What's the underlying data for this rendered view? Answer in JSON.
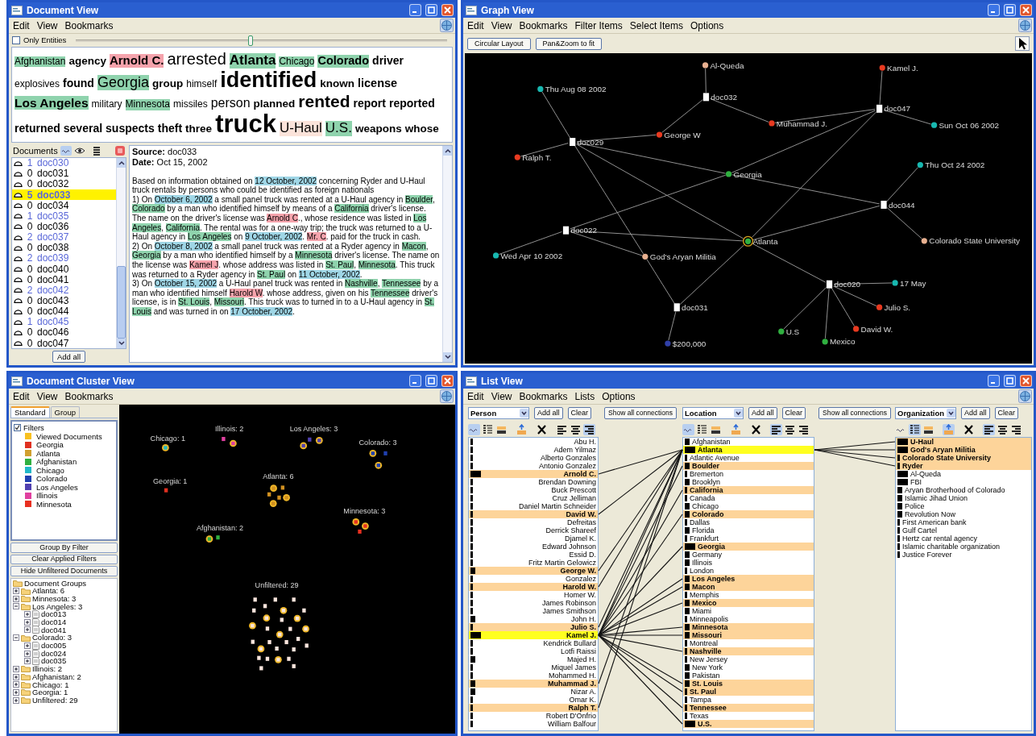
{
  "document_view": {
    "title": "Document View",
    "menu": [
      "Edit",
      "View",
      "Bookmarks"
    ],
    "only_entities": {
      "label": "Only Entities",
      "checked": false
    },
    "slider": {
      "level": 0.47
    },
    "word_cloud": [
      {
        "text": "Afghanistan",
        "kind": "location"
      },
      {
        "text": "agency",
        "kind": "term"
      },
      {
        "text": "Arnold C.",
        "kind": "person"
      },
      {
        "text": "arrested",
        "kind": "term"
      },
      {
        "text": "Atlanta",
        "kind": "location"
      },
      {
        "text": "Chicago",
        "kind": "location"
      },
      {
        "text": "Colorado",
        "kind": "location"
      },
      {
        "text": "driver",
        "kind": "term"
      },
      {
        "text": "explosives",
        "kind": "term"
      },
      {
        "text": "found",
        "kind": "term"
      },
      {
        "text": "Georgia",
        "kind": "location"
      },
      {
        "text": "group",
        "kind": "term"
      },
      {
        "text": "himself",
        "kind": "term"
      },
      {
        "text": "identified",
        "kind": "term"
      },
      {
        "text": "known",
        "kind": "term"
      },
      {
        "text": "license",
        "kind": "term"
      },
      {
        "text": "Los Angeles",
        "kind": "location"
      },
      {
        "text": "military",
        "kind": "term"
      },
      {
        "text": "Minnesota",
        "kind": "location"
      },
      {
        "text": "missiles",
        "kind": "term"
      },
      {
        "text": "person",
        "kind": "term"
      },
      {
        "text": "planned",
        "kind": "term"
      },
      {
        "text": "rented",
        "kind": "term"
      },
      {
        "text": "report",
        "kind": "term"
      },
      {
        "text": "reported",
        "kind": "term"
      },
      {
        "text": "returned",
        "kind": "term"
      },
      {
        "text": "several",
        "kind": "term"
      },
      {
        "text": "suspects",
        "kind": "term"
      },
      {
        "text": "theft",
        "kind": "term"
      },
      {
        "text": "three",
        "kind": "term"
      },
      {
        "text": "truck",
        "kind": "term"
      },
      {
        "text": "U-Haul",
        "kind": "organization"
      },
      {
        "text": "U.S.",
        "kind": "location"
      },
      {
        "text": "weapons",
        "kind": "term"
      },
      {
        "text": "whose",
        "kind": "term"
      }
    ],
    "documents_panel": {
      "title": "Documents",
      "add_all": "Add all",
      "items": [
        {
          "count": "1",
          "name": "doc030",
          "linked": true,
          "selected": false
        },
        {
          "count": "0",
          "name": "doc031",
          "linked": false,
          "selected": false
        },
        {
          "count": "0",
          "name": "doc032",
          "linked": false,
          "selected": false
        },
        {
          "count": "5",
          "name": "doc033",
          "linked": true,
          "selected": true
        },
        {
          "count": "0",
          "name": "doc034",
          "linked": false,
          "selected": false
        },
        {
          "count": "1",
          "name": "doc035",
          "linked": true,
          "selected": false
        },
        {
          "count": "0",
          "name": "doc036",
          "linked": false,
          "selected": false
        },
        {
          "count": "2",
          "name": "doc037",
          "linked": true,
          "selected": false
        },
        {
          "count": "0",
          "name": "doc038",
          "linked": false,
          "selected": false
        },
        {
          "count": "2",
          "name": "doc039",
          "linked": true,
          "selected": false
        },
        {
          "count": "0",
          "name": "doc040",
          "linked": false,
          "selected": false
        },
        {
          "count": "0",
          "name": "doc041",
          "linked": false,
          "selected": false
        },
        {
          "count": "2",
          "name": "doc042",
          "linked": true,
          "selected": false
        },
        {
          "count": "0",
          "name": "doc043",
          "linked": false,
          "selected": false
        },
        {
          "count": "0",
          "name": "doc044",
          "linked": false,
          "selected": false
        },
        {
          "count": "1",
          "name": "doc045",
          "linked": true,
          "selected": false
        },
        {
          "count": "0",
          "name": "doc046",
          "linked": false,
          "selected": false
        },
        {
          "count": "0",
          "name": "doc047",
          "linked": false,
          "selected": false
        }
      ]
    },
    "document": {
      "source": "**Source:** doc033",
      "date": "**Date:** Oct 15, 2002",
      "paragraphs": [
        [
          {
            "text": "Based on information obtained on "
          },
          {
            "text": "12 October, 2002",
            "kind": "date"
          },
          {
            "text": " concerning Ryder and U-Haul truck rentals by persons who could be identified as foreign nationals"
          }
        ],
        [
          {
            "text": "1) On "
          },
          {
            "text": "October 6, 2002",
            "kind": "date"
          },
          {
            "text": " a small panel truck was rented at a U-Haul agency in "
          },
          {
            "text": "Boulder",
            "kind": "location"
          },
          {
            "text": ", "
          },
          {
            "text": "Colorado",
            "kind": "location"
          },
          {
            "text": " by a man who identified himself by means of a "
          },
          {
            "text": "California",
            "kind": "location"
          },
          {
            "text": " driver's license. The name on the driver's license was "
          },
          {
            "text": "Arnold C",
            "kind": "person"
          },
          {
            "text": "., whose residence was listed in "
          },
          {
            "text": "Los Angeles",
            "kind": "location"
          },
          {
            "text": ", "
          },
          {
            "text": "California",
            "kind": "location"
          },
          {
            "text": ". The rental was for a one-way trip; the truck was returned to a U-Haul agency in "
          },
          {
            "text": "Los Angeles",
            "kind": "location"
          },
          {
            "text": " on "
          },
          {
            "text": "9 October, 2002",
            "kind": "date"
          },
          {
            "text": ". "
          },
          {
            "text": "Mr. C",
            "kind": "person"
          },
          {
            "text": ". paid for the truck in cash."
          }
        ],
        [
          {
            "text": "2) On "
          },
          {
            "text": "October 8, 2002",
            "kind": "date"
          },
          {
            "text": " a small panel truck was rented at a Ryder agency in "
          },
          {
            "text": "Macon",
            "kind": "location"
          },
          {
            "text": ", "
          },
          {
            "text": "Georgia",
            "kind": "location"
          },
          {
            "text": " by a man who identified himself by a "
          },
          {
            "text": "Minnesota",
            "kind": "location"
          },
          {
            "text": " driver's license. The name on the license was "
          },
          {
            "text": "Kamel J",
            "kind": "person"
          },
          {
            "text": ". whose address was listed in "
          },
          {
            "text": "St. Paul",
            "kind": "location"
          },
          {
            "text": ", "
          },
          {
            "text": "Minnesota",
            "kind": "location"
          },
          {
            "text": ". This truck was returned to a Ryder agency in "
          },
          {
            "text": "St. Paul",
            "kind": "location"
          },
          {
            "text": " on "
          },
          {
            "text": "11 October, 2002",
            "kind": "date"
          },
          {
            "text": "."
          }
        ],
        [
          {
            "text": "3) On "
          },
          {
            "text": "October 15, 2002",
            "kind": "date"
          },
          {
            "text": " a U-Haul panel truck was rented in "
          },
          {
            "text": "Nashville",
            "kind": "location"
          },
          {
            "text": ", "
          },
          {
            "text": "Tennessee",
            "kind": "location"
          },
          {
            "text": " by a man who identified himself "
          },
          {
            "text": "Harold W",
            "kind": "person"
          },
          {
            "text": ". whose address, given on his "
          },
          {
            "text": "Tennessee",
            "kind": "location"
          },
          {
            "text": " driver's license, is in "
          },
          {
            "text": "St. Louis",
            "kind": "location"
          },
          {
            "text": ", "
          },
          {
            "text": "Missouri",
            "kind": "location"
          },
          {
            "text": ". This truck was to turned in to a U-Haul agency in "
          },
          {
            "text": "St. Louis",
            "kind": "location"
          },
          {
            "text": " and was turned in on "
          },
          {
            "text": "17 October, 2002",
            "kind": "date"
          },
          {
            "text": "."
          }
        ]
      ]
    }
  },
  "graph_view": {
    "title": "Graph View",
    "menu": [
      "Edit",
      "View",
      "Bookmarks",
      "Filter Items",
      "Select Items",
      "Options"
    ],
    "buttons": [
      "Circular Layout",
      "Pan&Zoom to fit"
    ],
    "nodes": [
      {
        "label": "Al-Queda",
        "kind": "entity",
        "color": "#e8b090",
        "selected": false
      },
      {
        "label": "doc032",
        "kind": "document",
        "selected": false
      },
      {
        "label": "Kamel J.",
        "kind": "entity",
        "color": "#e83a20",
        "selected": false
      },
      {
        "label": "Thu Aug 08 2002",
        "kind": "entity",
        "color": "#18b8b0",
        "selected": false
      },
      {
        "label": "doc047",
        "kind": "document",
        "selected": false
      },
      {
        "label": "Muhammad J.",
        "kind": "entity",
        "color": "#e83a20",
        "selected": false
      },
      {
        "label": "Sun Oct 06 2002",
        "kind": "entity",
        "color": "#18b8b0",
        "selected": false
      },
      {
        "label": "George W",
        "kind": "entity",
        "color": "#e83a20",
        "selected": false
      },
      {
        "label": "doc029",
        "kind": "document",
        "selected": false
      },
      {
        "label": "Ralph T.",
        "kind": "entity",
        "color": "#e83a20",
        "selected": false
      },
      {
        "label": "Georgia",
        "kind": "entity",
        "color": "#30b040",
        "selected": false
      },
      {
        "label": "Thu Oct 24 2002",
        "kind": "entity",
        "color": "#18b8b0",
        "selected": false
      },
      {
        "label": "doc044",
        "kind": "document",
        "selected": false
      },
      {
        "label": "doc022",
        "kind": "document",
        "selected": false
      },
      {
        "label": "Atlanta",
        "kind": "entity",
        "color": "#30b040",
        "selected": true
      },
      {
        "label": "Colorado State University",
        "kind": "entity",
        "color": "#e8b090",
        "selected": false
      },
      {
        "label": "Wed Apr 10 2002",
        "kind": "entity",
        "color": "#18b8b0",
        "selected": false
      },
      {
        "label": "God's Aryan Militia",
        "kind": "entity",
        "color": "#e8b090",
        "selected": false
      },
      {
        "label": "doc020",
        "kind": "document",
        "selected": false
      },
      {
        "label": "17 May",
        "kind": "entity",
        "color": "#18b8b0",
        "selected": false
      },
      {
        "label": "Julio S.",
        "kind": "entity",
        "color": "#e83a20",
        "selected": false
      },
      {
        "label": "doc031",
        "kind": "document",
        "selected": false
      },
      {
        "label": "David W.",
        "kind": "entity",
        "color": "#e83a20",
        "selected": false
      },
      {
        "label": "U.S",
        "kind": "entity",
        "color": "#30b040",
        "selected": false
      },
      {
        "label": "Mexico",
        "kind": "entity",
        "color": "#30b040",
        "selected": false
      },
      {
        "label": "$200,000",
        "kind": "entity",
        "color": "#3040a8",
        "selected": false
      }
    ]
  },
  "cluster_view": {
    "title": "Document Cluster View",
    "menu": [
      "Edit",
      "View",
      "Bookmarks"
    ],
    "tabs": [
      {
        "label": "Standard",
        "selected": true
      },
      {
        "label": "Group",
        "selected": false
      }
    ],
    "filters": {
      "label": "Filters",
      "checked": true,
      "items": [
        {
          "label": "Viewed Documents",
          "color": "#f8c020"
        },
        {
          "label": "Georgia",
          "color": "#e03020"
        },
        {
          "label": "Atlanta",
          "color": "#d0a030"
        },
        {
          "label": "Afghanistan",
          "color": "#30b040"
        },
        {
          "label": "Chicago",
          "color": "#20b8c8"
        },
        {
          "label": "Colorado",
          "color": "#2040b0"
        },
        {
          "label": "Los Angeles",
          "color": "#5040b0"
        },
        {
          "label": "Illinois",
          "color": "#e040a0"
        },
        {
          "label": "Minnesota",
          "color": "#e83020"
        }
      ]
    },
    "buttons": [
      "Group By Filter",
      "Clear Applied Filters",
      "Hide Unfiltered Documents"
    ],
    "groups": {
      "label": "Document Groups",
      "kind": "folder",
      "children": [
        {
          "label": "Atlanta: 6",
          "kind": "folder",
          "expanded": false
        },
        {
          "label": "Minnesota: 3",
          "kind": "folder",
          "expanded": false
        },
        {
          "label": "Los Angeles: 3",
          "kind": "folder",
          "expanded": true,
          "children": [
            {
              "label": "doc013",
              "kind": "document",
              "expanded": false
            },
            {
              "label": "doc014",
              "kind": "document",
              "expanded": false
            },
            {
              "label": "doc041",
              "kind": "document",
              "expanded": false
            }
          ]
        },
        {
          "label": "Colorado: 3",
          "kind": "folder",
          "expanded": true,
          "children": [
            {
              "label": "doc005",
              "kind": "document",
              "expanded": false
            },
            {
              "label": "doc024",
              "kind": "document",
              "expanded": false
            },
            {
              "label": "doc035",
              "kind": "document",
              "expanded": false
            }
          ]
        },
        {
          "label": "Illinois: 2",
          "kind": "folder",
          "expanded": false
        },
        {
          "label": "Afghanistan: 2",
          "kind": "folder",
          "expanded": false
        },
        {
          "label": "Chicago: 1",
          "kind": "folder",
          "expanded": false
        },
        {
          "label": "Georgia: 1",
          "kind": "folder",
          "expanded": false
        },
        {
          "label": "Unfiltered: 29",
          "kind": "folder",
          "expanded": false
        }
      ]
    },
    "clusters": [
      {
        "label": "Chicago: 1",
        "color": "#20b8c8"
      },
      {
        "label": "Illinois: 2",
        "color": "#e040a0"
      },
      {
        "label": "Los Angeles: 3",
        "color": "#5040b0"
      },
      {
        "label": "Colorado: 3",
        "color": "#2040b0"
      },
      {
        "label": "Georgia: 1",
        "color": "#e03020"
      },
      {
        "label": "Atlanta: 6",
        "color": "#d09020"
      },
      {
        "label": "Minnesota: 3",
        "color": "#e83020"
      },
      {
        "label": "Afghanistan: 2",
        "color": "#30b040"
      },
      {
        "label": "Unfiltered: 29",
        "color": "#f8e4dc"
      }
    ]
  },
  "list_view": {
    "title": "List View",
    "menu": [
      "Edit",
      "View",
      "Bookmarks",
      "Lists",
      "Options"
    ],
    "connections_buttons": [
      "Show all connections",
      "Show all connections"
    ],
    "lists": [
      {
        "type": "Person",
        "add_all": "Add all",
        "clear": "Clear",
        "tools": [
          {
            "kind": "text",
            "selected": true
          },
          {
            "kind": "tree",
            "selected": false
          },
          {
            "kind": "bar",
            "selected": false
          },
          {
            "kind": "sort",
            "selected": false
          },
          {
            "kind": "clear",
            "selected": false
          },
          {
            "kind": "align-left",
            "selected": false
          },
          {
            "kind": "align-center",
            "selected": false
          },
          {
            "kind": "align-right",
            "selected": true
          }
        ],
        "items": [
          {
            "label": "Abu H.",
            "kind": "thin",
            "highlighted": false,
            "selected": false
          },
          {
            "label": "Adem Yilmaz",
            "kind": "thin",
            "highlighted": false,
            "selected": false
          },
          {
            "label": "Alberto Gonzales",
            "kind": "thin",
            "highlighted": false,
            "selected": false
          },
          {
            "label": "Antonio Gonzalez",
            "kind": "thin",
            "highlighted": false,
            "selected": false
          },
          {
            "label": "Arnold C.",
            "kind": "wide",
            "highlighted": true,
            "selected": false
          },
          {
            "label": "Brendan Downing",
            "kind": "thin",
            "highlighted": false,
            "selected": false
          },
          {
            "label": "Buck Prescott",
            "kind": "thin",
            "highlighted": false,
            "selected": false
          },
          {
            "label": "Cruz Jelliman",
            "kind": "thin",
            "highlighted": false,
            "selected": false
          },
          {
            "label": "Daniel Martin Schneider",
            "kind": "thin",
            "highlighted": false,
            "selected": false
          },
          {
            "label": "David W.",
            "kind": "thin",
            "highlighted": true,
            "selected": false
          },
          {
            "label": "Defreitas",
            "kind": "thin",
            "highlighted": false,
            "selected": false
          },
          {
            "label": "Derrick Shareef",
            "kind": "thin",
            "highlighted": false,
            "selected": false
          },
          {
            "label": "Djamel K.",
            "kind": "thin",
            "highlighted": false,
            "selected": false
          },
          {
            "label": "Edward Johnson",
            "kind": "thin",
            "highlighted": false,
            "selected": false
          },
          {
            "label": "Essid D.",
            "kind": "thin",
            "highlighted": false,
            "selected": false
          },
          {
            "label": "Fritz Martin Gelowicz",
            "kind": "thin",
            "highlighted": false,
            "selected": false
          },
          {
            "label": "George W.",
            "kind": "medium",
            "highlighted": true,
            "selected": false
          },
          {
            "label": "Gonzalez",
            "kind": "thin",
            "highlighted": false,
            "selected": false
          },
          {
            "label": "Harold W.",
            "kind": "thin",
            "highlighted": true,
            "selected": false
          },
          {
            "label": "Homer W.",
            "kind": "thin",
            "highlighted": false,
            "selected": false
          },
          {
            "label": "James Robinson",
            "kind": "thin",
            "highlighted": false,
            "selected": false
          },
          {
            "label": "James Smithson",
            "kind": "thin",
            "highlighted": false,
            "selected": false
          },
          {
            "label": "John H.",
            "kind": "medium",
            "highlighted": false,
            "selected": false
          },
          {
            "label": "Julio S.",
            "kind": "thin",
            "highlighted": true,
            "selected": false
          },
          {
            "label": "Kamel J.",
            "kind": "wide",
            "highlighted": false,
            "selected": true
          },
          {
            "label": "Kendrick Bullard",
            "kind": "thin",
            "highlighted": false,
            "selected": false
          },
          {
            "label": "Lotfi Raissi",
            "kind": "thin",
            "highlighted": false,
            "selected": false
          },
          {
            "label": "Majed H.",
            "kind": "medium",
            "highlighted": false,
            "selected": false
          },
          {
            "label": "Miquel James",
            "kind": "thin",
            "highlighted": false,
            "selected": false
          },
          {
            "label": "Mohammed H.",
            "kind": "thin",
            "highlighted": false,
            "selected": false
          },
          {
            "label": "Muhammad J.",
            "kind": "medium",
            "highlighted": true,
            "selected": false
          },
          {
            "label": "Nizar A.",
            "kind": "medium",
            "highlighted": false,
            "selected": false
          },
          {
            "label": "Omar K.",
            "kind": "thin",
            "highlighted": false,
            "selected": false
          },
          {
            "label": "Ralph T.",
            "kind": "thin",
            "highlighted": true,
            "selected": false
          },
          {
            "label": "Robert D'Onfrio",
            "kind": "thin",
            "highlighted": false,
            "selected": false
          },
          {
            "label": "William Balfour",
            "kind": "thin",
            "highlighted": false,
            "selected": false
          }
        ]
      },
      {
        "type": "Location",
        "add_all": "Add all",
        "clear": "Clear",
        "tools": [
          {
            "kind": "text",
            "selected": true
          },
          {
            "kind": "tree",
            "selected": false
          },
          {
            "kind": "bar",
            "selected": false
          },
          {
            "kind": "sort",
            "selected": false
          },
          {
            "kind": "clear",
            "selected": false
          },
          {
            "kind": "align-left",
            "selected": true
          },
          {
            "kind": "align-center",
            "selected": false
          },
          {
            "kind": "align-right",
            "selected": false
          }
        ],
        "items": [
          {
            "label": "Afghanistan",
            "kind": "medium",
            "highlighted": false,
            "selected": false
          },
          {
            "label": "Atlanta",
            "kind": "wide",
            "highlighted": false,
            "selected": true
          },
          {
            "label": "Atlantic Avenue",
            "kind": "thin",
            "highlighted": false,
            "selected": false
          },
          {
            "label": "Boulder",
            "kind": "medium",
            "highlighted": true,
            "selected": false
          },
          {
            "label": "Bremerton",
            "kind": "thin",
            "highlighted": false,
            "selected": false
          },
          {
            "label": "Brooklyn",
            "kind": "medium",
            "highlighted": false,
            "selected": false
          },
          {
            "label": "California",
            "kind": "thin",
            "highlighted": true,
            "selected": false
          },
          {
            "label": "Canada",
            "kind": "thin",
            "highlighted": false,
            "selected": false
          },
          {
            "label": "Chicago",
            "kind": "medium",
            "highlighted": false,
            "selected": false
          },
          {
            "label": "Colorado",
            "kind": "medium",
            "highlighted": true,
            "selected": false
          },
          {
            "label": "Dallas",
            "kind": "thin",
            "highlighted": false,
            "selected": false
          },
          {
            "label": "Florida",
            "kind": "medium",
            "highlighted": false,
            "selected": false
          },
          {
            "label": "Frankfurt",
            "kind": "thin",
            "highlighted": false,
            "selected": false
          },
          {
            "label": "Georgia",
            "kind": "wide",
            "highlighted": true,
            "selected": false
          },
          {
            "label": "Germany",
            "kind": "medium",
            "highlighted": false,
            "selected": false
          },
          {
            "label": "Illinois",
            "kind": "medium",
            "highlighted": false,
            "selected": false
          },
          {
            "label": "London",
            "kind": "thin",
            "highlighted": false,
            "selected": false
          },
          {
            "label": "Los Angeles",
            "kind": "medium",
            "highlighted": true,
            "selected": false
          },
          {
            "label": "Macon",
            "kind": "medium",
            "highlighted": true,
            "selected": false
          },
          {
            "label": "Memphis",
            "kind": "thin",
            "highlighted": false,
            "selected": false
          },
          {
            "label": "Mexico",
            "kind": "medium",
            "highlighted": true,
            "selected": false
          },
          {
            "label": "Miami",
            "kind": "medium",
            "highlighted": false,
            "selected": false
          },
          {
            "label": "Minneapolis",
            "kind": "thin",
            "highlighted": false,
            "selected": false
          },
          {
            "label": "Minnesota",
            "kind": "medium",
            "highlighted": true,
            "selected": false
          },
          {
            "label": "Missouri",
            "kind": "medium",
            "highlighted": true,
            "selected": false
          },
          {
            "label": "Montreal",
            "kind": "thin",
            "highlighted": false,
            "selected": false
          },
          {
            "label": "Nashville",
            "kind": "thin",
            "highlighted": true,
            "selected": false
          },
          {
            "label": "New Jersey",
            "kind": "thin",
            "highlighted": false,
            "selected": false
          },
          {
            "label": "New York",
            "kind": "medium",
            "highlighted": false,
            "selected": false
          },
          {
            "label": "Pakistan",
            "kind": "medium",
            "highlighted": false,
            "selected": false
          },
          {
            "label": "St. Louis",
            "kind": "medium",
            "highlighted": true,
            "selected": false
          },
          {
            "label": "St. Paul",
            "kind": "thin",
            "highlighted": true,
            "selected": false
          },
          {
            "label": "Tampa",
            "kind": "thin",
            "highlighted": false,
            "selected": false
          },
          {
            "label": "Tennessee",
            "kind": "thin",
            "highlighted": true,
            "selected": false
          },
          {
            "label": "Texas",
            "kind": "thin",
            "highlighted": false,
            "selected": false
          },
          {
            "label": "U.S.",
            "kind": "wide",
            "highlighted": true,
            "selected": false
          }
        ]
      },
      {
        "type": "Organization",
        "add_all": "Add all",
        "clear": "Clear",
        "tools": [
          {
            "kind": "text",
            "selected": false
          },
          {
            "kind": "tree",
            "selected": true
          },
          {
            "kind": "bar",
            "selected": false
          },
          {
            "kind": "sort",
            "selected": true
          },
          {
            "kind": "clear",
            "selected": false
          },
          {
            "kind": "align-left",
            "selected": true
          },
          {
            "kind": "align-center",
            "selected": false
          },
          {
            "kind": "align-right",
            "selected": false
          }
        ],
        "items": [
          {
            "label": "U-Haul",
            "kind": "wide",
            "highlighted": true,
            "selected": false
          },
          {
            "label": "God's Aryan Militia",
            "kind": "wide",
            "highlighted": true,
            "selected": false
          },
          {
            "label": "Colorado State University",
            "kind": "thin",
            "highlighted": true,
            "selected": false
          },
          {
            "label": "Ryder",
            "kind": "thin",
            "highlighted": true,
            "selected": false
          },
          {
            "label": "Al-Queda",
            "kind": "wide",
            "highlighted": false,
            "selected": false
          },
          {
            "label": "FBI",
            "kind": "wide",
            "highlighted": false,
            "selected": false
          },
          {
            "label": "Aryan Brotherhood of Colorado",
            "kind": "medium",
            "highlighted": false,
            "selected": false
          },
          {
            "label": "Islamic Jihad Union",
            "kind": "medium",
            "highlighted": false,
            "selected": false
          },
          {
            "label": "Police",
            "kind": "medium",
            "highlighted": false,
            "selected": false
          },
          {
            "label": "Revolution Now",
            "kind": "medium",
            "highlighted": false,
            "selected": false
          },
          {
            "label": "First American bank",
            "kind": "thin",
            "highlighted": false,
            "selected": false
          },
          {
            "label": "Gulf Cartel",
            "kind": "thin",
            "highlighted": false,
            "selected": false
          },
          {
            "label": "Hertz car rental agency",
            "kind": "thin",
            "highlighted": false,
            "selected": false
          },
          {
            "label": "Islamic charitable organization",
            "kind": "thin",
            "highlighted": false,
            "selected": false
          },
          {
            "label": "Justice Forever",
            "kind": "thin",
            "highlighted": false,
            "selected": false
          }
        ]
      }
    ]
  }
}
